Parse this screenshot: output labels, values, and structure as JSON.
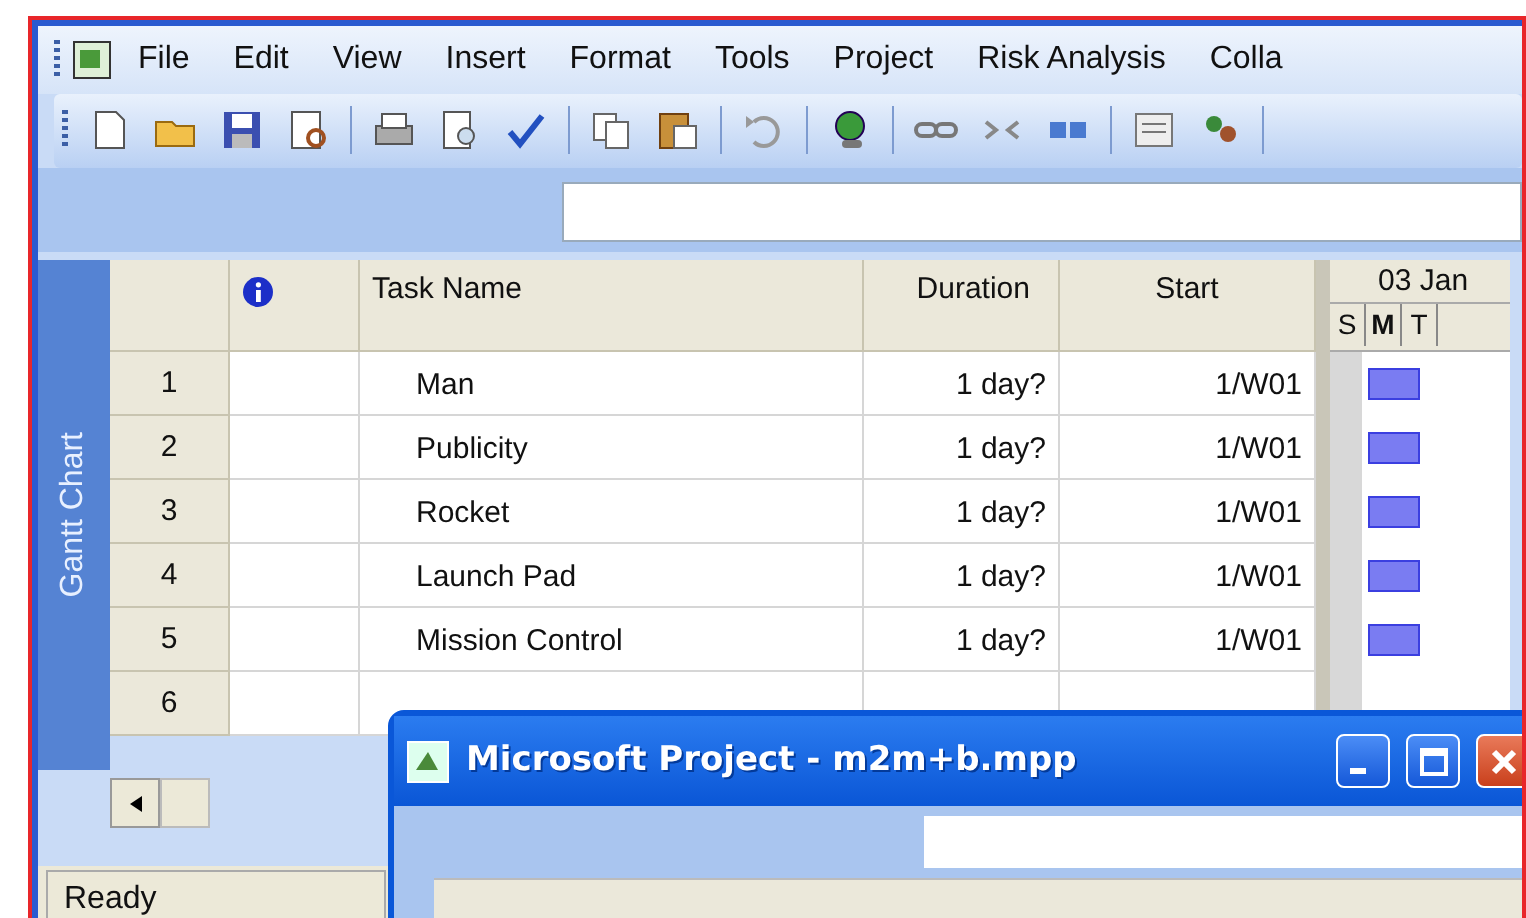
{
  "menu": [
    "File",
    "Edit",
    "View",
    "Insert",
    "Format",
    "Tools",
    "Project",
    "Risk Analysis",
    "Colla"
  ],
  "view_bar": {
    "label": "Gantt Chart"
  },
  "table": {
    "columns": [
      "Task Name",
      "Duration",
      "Start"
    ],
    "rows": [
      {
        "id": "1",
        "name": "Man",
        "duration": "1 day?",
        "start": "1/W01"
      },
      {
        "id": "2",
        "name": "Publicity",
        "duration": "1 day?",
        "start": "1/W01"
      },
      {
        "id": "3",
        "name": "Rocket",
        "duration": "1 day?",
        "start": "1/W01"
      },
      {
        "id": "4",
        "name": "Launch Pad",
        "duration": "1 day?",
        "start": "1/W01"
      },
      {
        "id": "5",
        "name": "Mission Control",
        "duration": "1 day?",
        "start": "1/W01"
      },
      {
        "id": "6"
      }
    ]
  },
  "gantt": {
    "week": "03 Jan",
    "days": [
      "S",
      "M",
      "T"
    ]
  },
  "status_bar": "Ready",
  "dialog": {
    "title": "Microsoft Project - m2m+b.mpp"
  }
}
